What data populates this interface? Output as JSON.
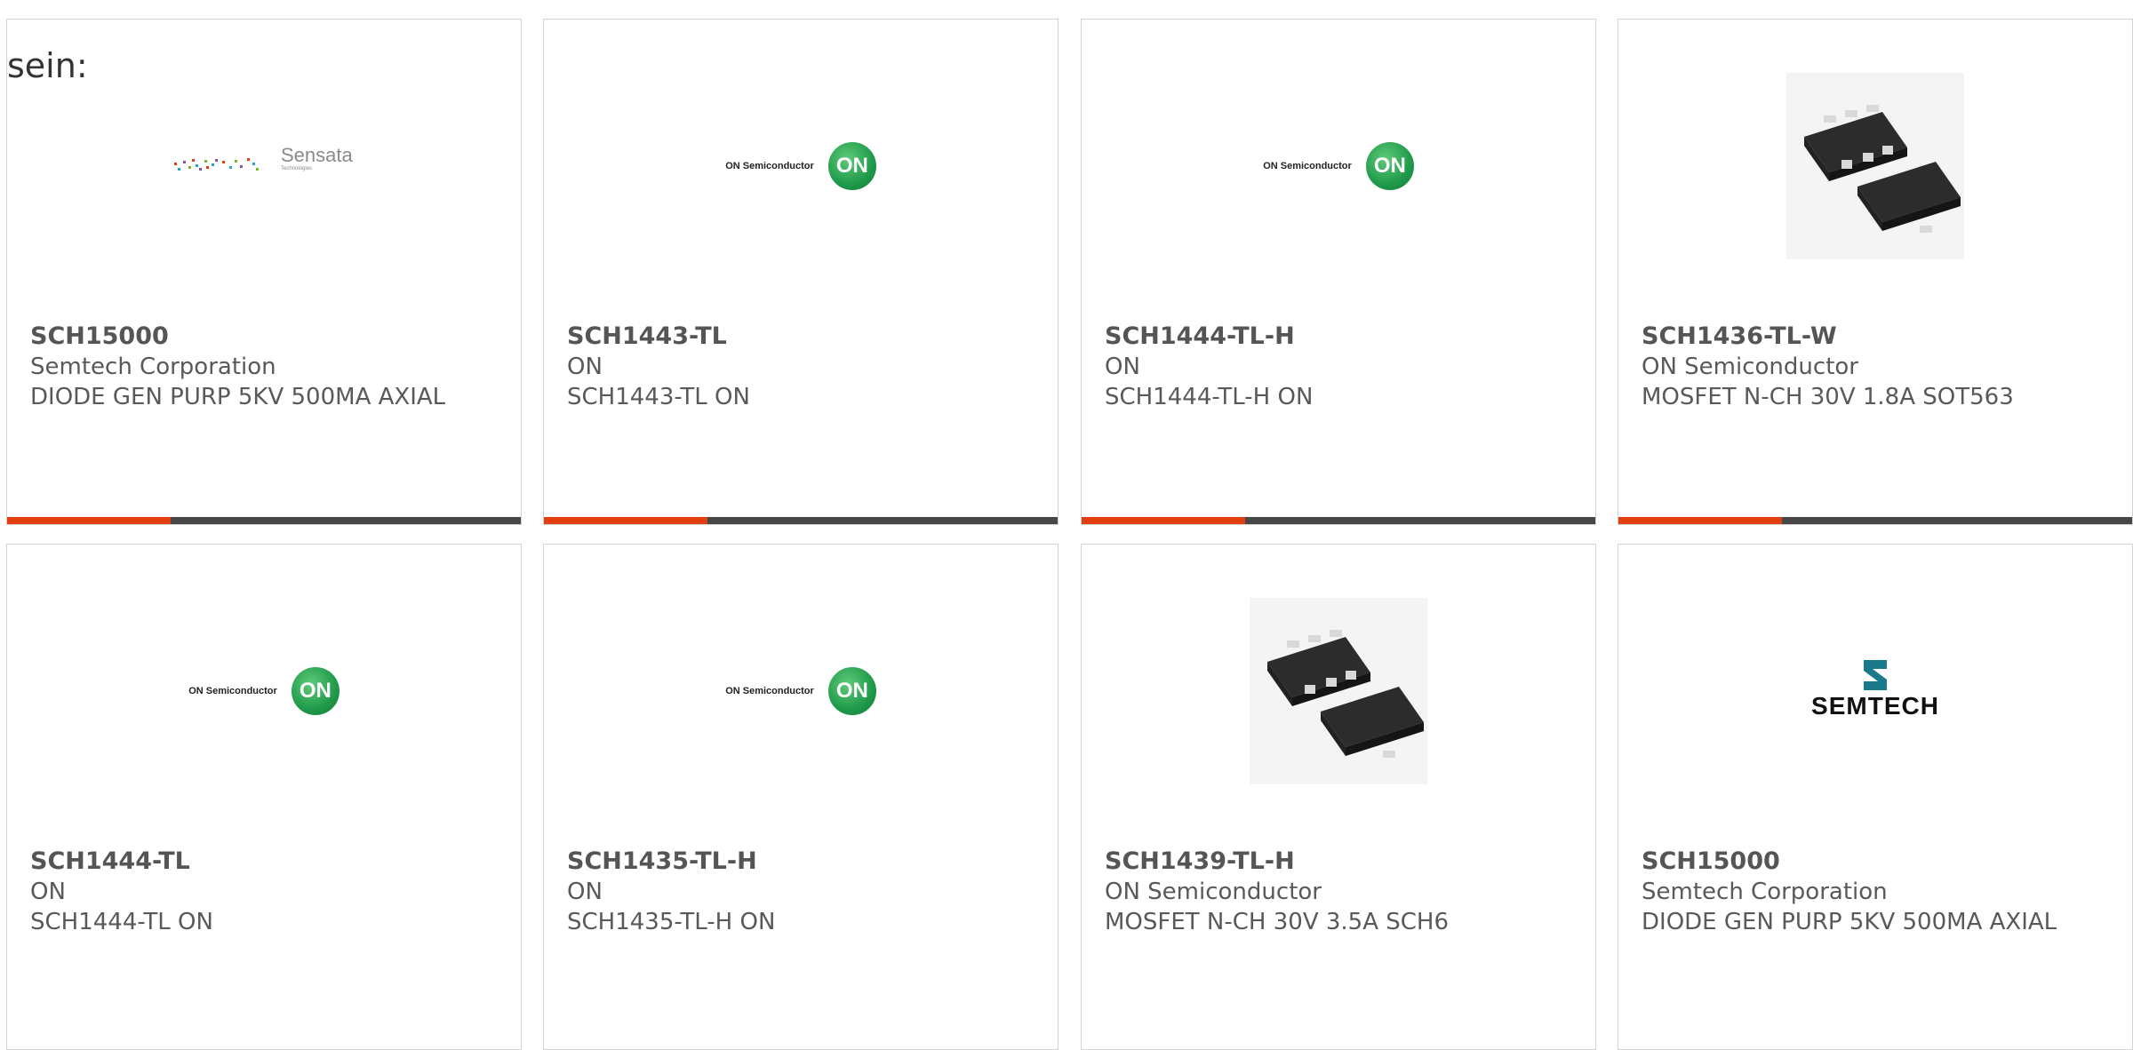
{
  "intro_text": "sein:",
  "products": [
    {
      "part": "SCH15000",
      "manufacturer": "Semtech Corporation",
      "description": "DIODE GEN PURP 5KV 500MA AXIAL",
      "image": "sensata-logo",
      "logo_text": "Sensata",
      "logo_subtext": "Technologies"
    },
    {
      "part": "SCH1443-TL",
      "manufacturer": "ON",
      "description": "SCH1443-TL ON",
      "image": "on-semiconductor-logo",
      "logo_text": "ON Semiconductor",
      "logo_badge": "ON"
    },
    {
      "part": "SCH1444-TL-H",
      "manufacturer": "ON",
      "description": "SCH1444-TL-H ON",
      "image": "on-semiconductor-logo",
      "logo_text": "ON Semiconductor",
      "logo_badge": "ON"
    },
    {
      "part": "SCH1436-TL-W",
      "manufacturer": "ON Semiconductor",
      "description": "MOSFET N-CH 30V 1.8A SOT563",
      "image": "sot563-package-photo"
    },
    {
      "part": "SCH1444-TL",
      "manufacturer": "ON",
      "description": "SCH1444-TL ON",
      "image": "on-semiconductor-logo",
      "logo_text": "ON Semiconductor",
      "logo_badge": "ON"
    },
    {
      "part": "SCH1435-TL-H",
      "manufacturer": "ON",
      "description": "SCH1435-TL-H ON",
      "image": "on-semiconductor-logo",
      "logo_text": "ON Semiconductor",
      "logo_badge": "ON"
    },
    {
      "part": "SCH1439-TL-H",
      "manufacturer": "ON Semiconductor",
      "description": "MOSFET N-CH 30V 3.5A SCH6",
      "image": "sch6-package-photo"
    },
    {
      "part": "SCH15000",
      "manufacturer": "Semtech Corporation",
      "description": "DIODE GEN PURP 5KV 500MA AXIAL",
      "image": "semtech-logo",
      "logo_text": "SEMTECH"
    }
  ],
  "colors": {
    "accent": "#e23e12",
    "bar": "#474747",
    "border": "#d3d3d3",
    "text": "#595959",
    "on_green": "#1f9a4a"
  }
}
